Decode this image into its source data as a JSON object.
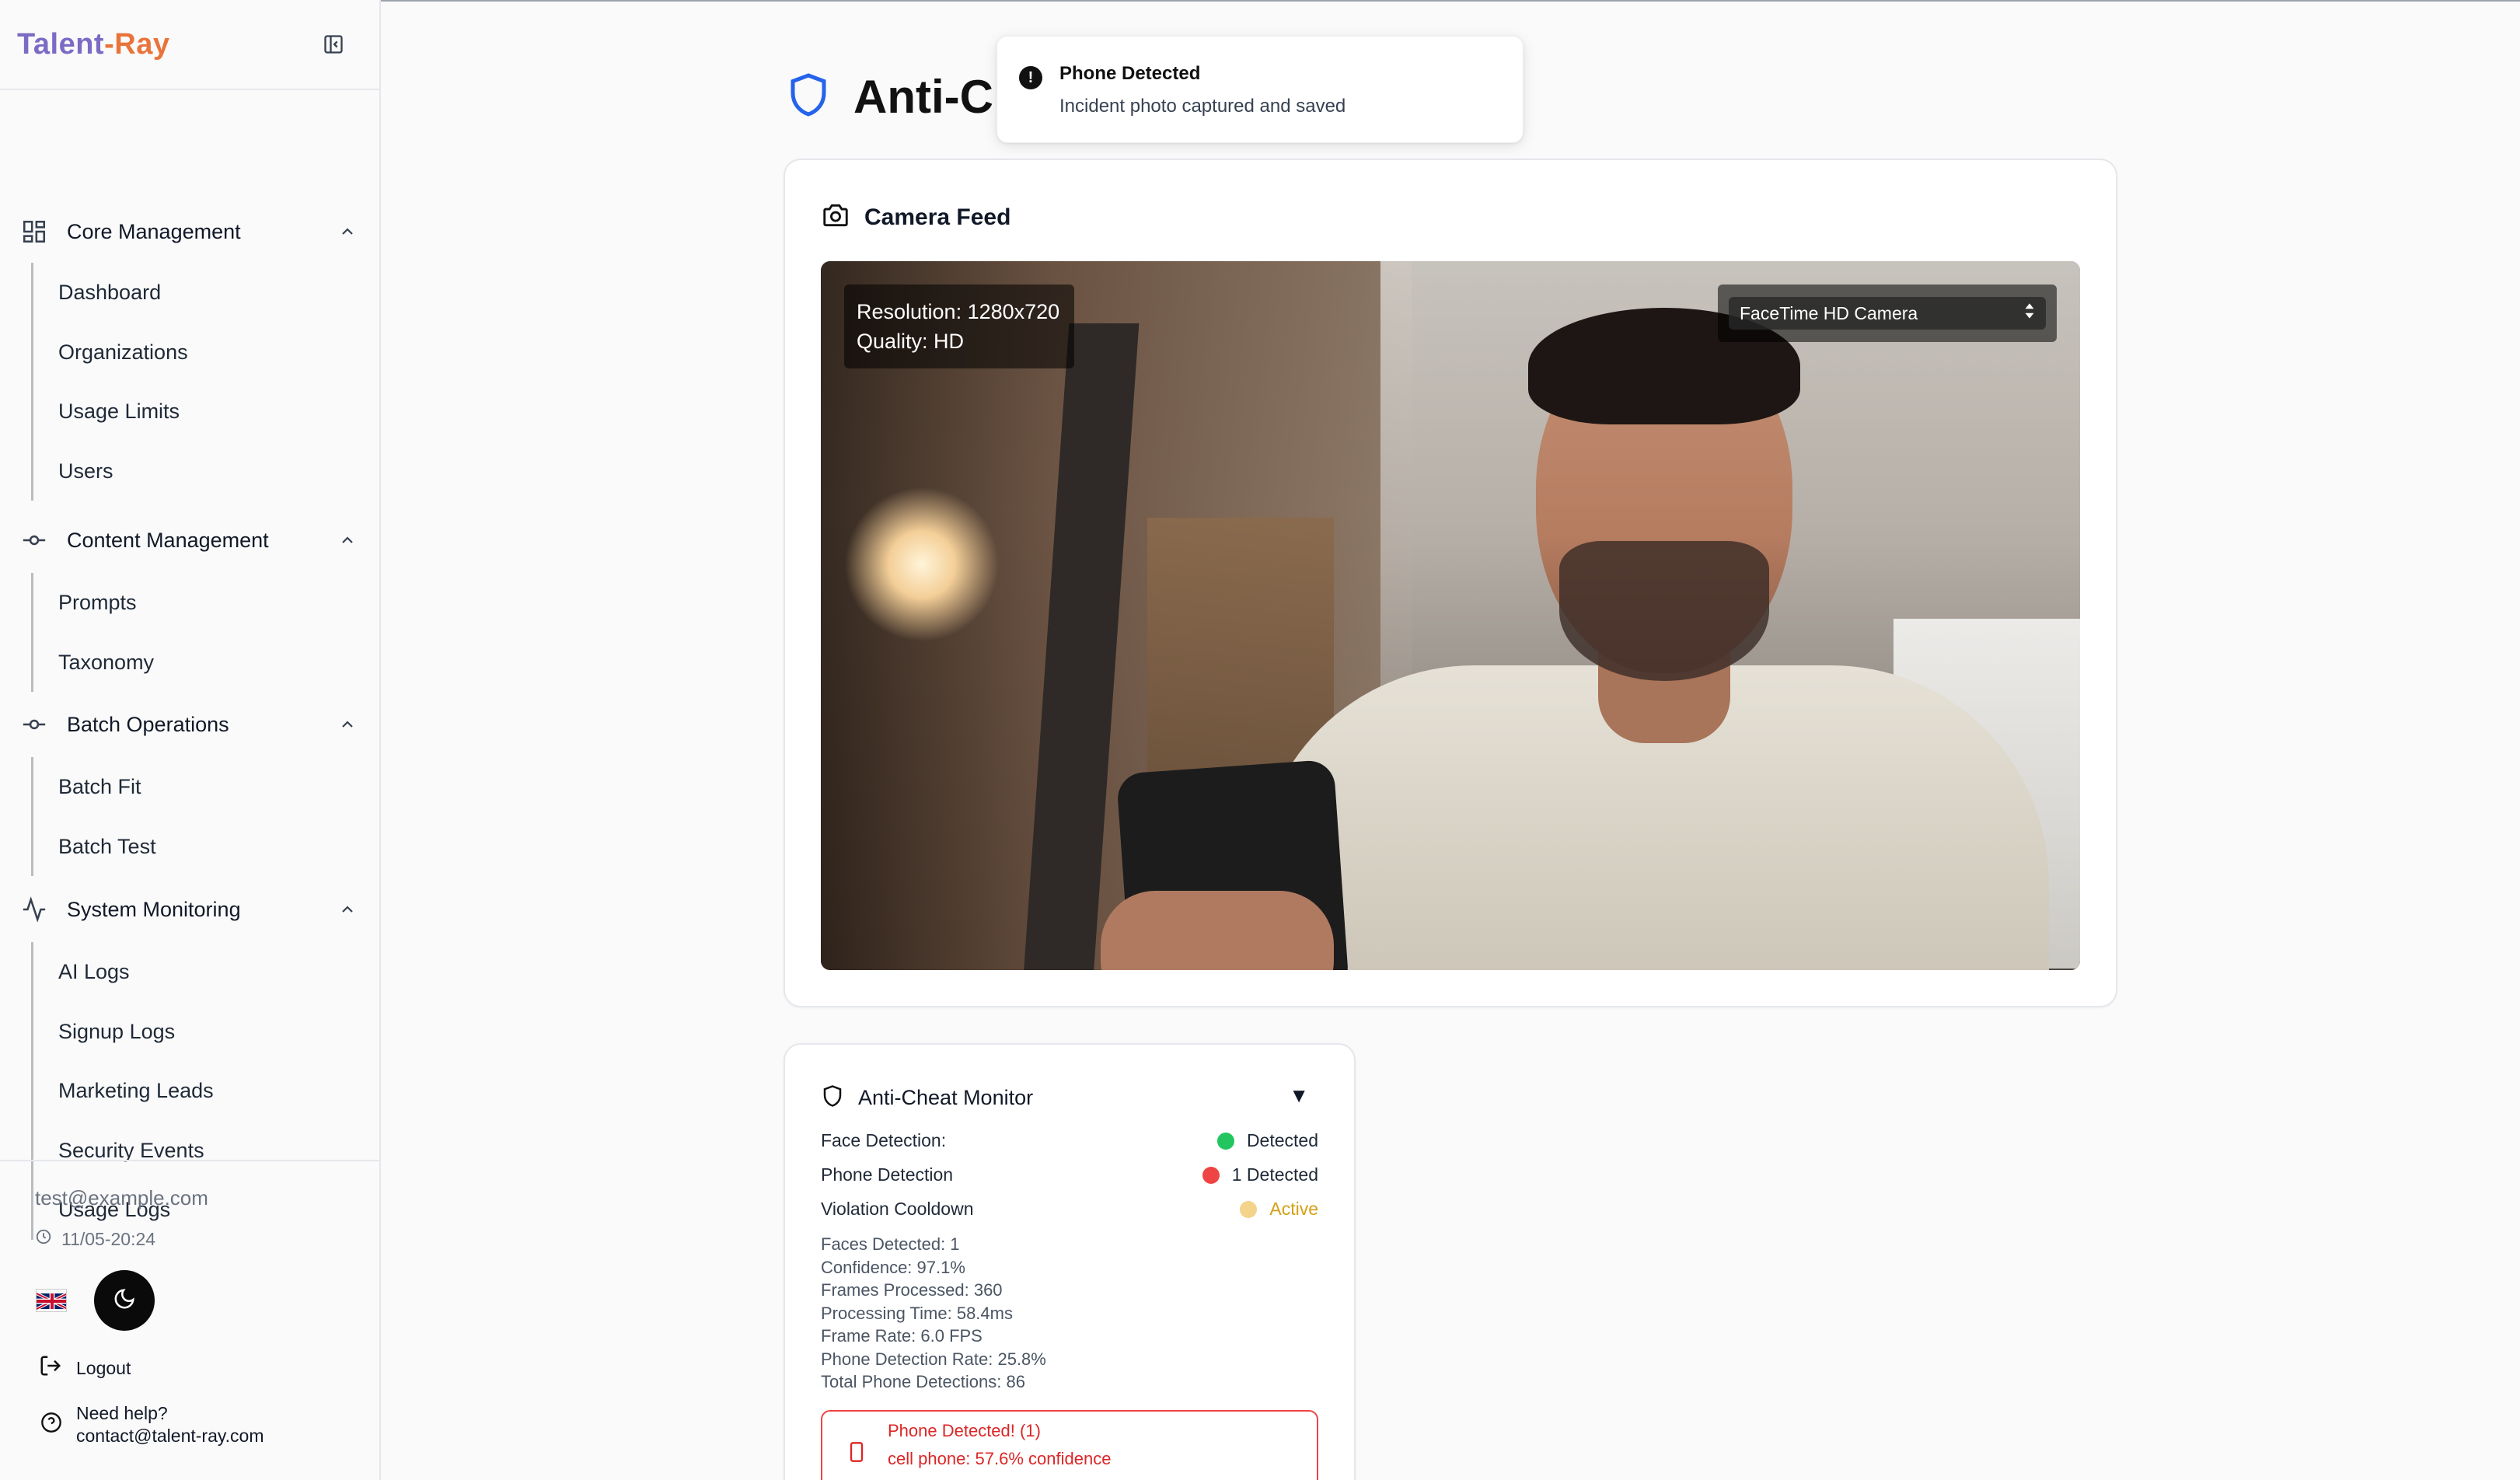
{
  "app": {
    "logo_part1": "Talent",
    "logo_part2": "-Ray"
  },
  "sidebar": {
    "sections": [
      {
        "title": "Core Management",
        "icon": "grid-icon",
        "items": [
          "Dashboard",
          "Organizations",
          "Usage Limits",
          "Users"
        ]
      },
      {
        "title": "Content Management",
        "icon": "commit-icon",
        "items": [
          "Prompts",
          "Taxonomy"
        ]
      },
      {
        "title": "Batch Operations",
        "icon": "commit-icon",
        "items": [
          "Batch Fit",
          "Batch Test"
        ]
      },
      {
        "title": "System Monitoring",
        "icon": "activity-icon",
        "items": [
          "AI Logs",
          "Signup Logs",
          "Marketing Leads",
          "Security Events",
          "Usage Logs"
        ]
      }
    ],
    "footer": {
      "email": "test@example.com",
      "datetime": "11/05-20:24",
      "logout_label": "Logout",
      "help_title": "Need help?",
      "help_contact": "contact@talent-ray.com"
    }
  },
  "page": {
    "title": "Anti-Cheat"
  },
  "toast": {
    "title": "Phone Detected",
    "description": "Incident photo captured and saved"
  },
  "camera": {
    "card_title": "Camera Feed",
    "resolution_text": "Resolution: 1280x720",
    "quality_text": "Quality: HD",
    "selected_camera": "FaceTime HD Camera"
  },
  "monitor": {
    "card_title": "Anti-Cheat Monitor",
    "toggle": "▼",
    "rows": [
      {
        "label": "Face Detection:",
        "value": "Detected",
        "color": "#22c55e"
      },
      {
        "label": "Phone Detection",
        "value": "1 Detected",
        "color": "#ef4444"
      },
      {
        "label": "Violation Cooldown",
        "value": "Active",
        "color": "#f4d38a"
      }
    ],
    "stats": [
      "Faces Detected: 1",
      "Confidence: 97.1%",
      "Frames Processed: 360",
      "Processing Time: 58.4ms",
      "Frame Rate: 6.0 FPS",
      "Phone Detection Rate: 25.8%",
      "Total Phone Detections: 86"
    ],
    "alert_title": "Phone Detected! (1)",
    "alert_detail": "cell phone: 57.6% confidence"
  },
  "colors": {
    "active_text": "#d4a017",
    "alert_red": "#dc2626"
  }
}
